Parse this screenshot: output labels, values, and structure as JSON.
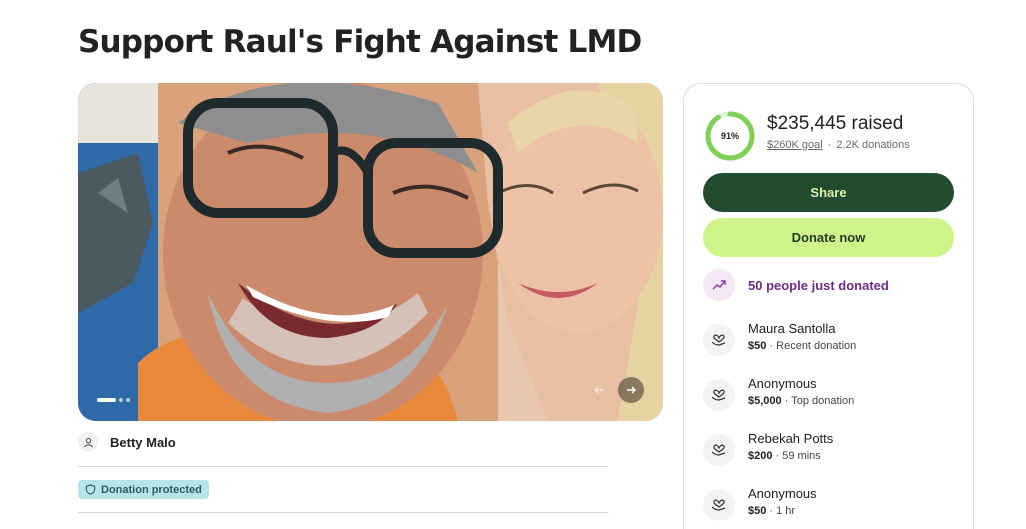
{
  "page": {
    "title": "Support Raul's Fight Against LMD"
  },
  "colors": {
    "accent_dark": "#224b30",
    "accent_light": "#cef48a",
    "progress_ring": "#7fcf58",
    "badge_bg": "#b5e5e8",
    "trend_text": "#6c2c8a"
  },
  "hero": {
    "slide_count": 3,
    "active_slide": 1,
    "prev_icon": "arrow-left-icon",
    "next_icon": "arrow-right-icon"
  },
  "organizer": {
    "name": "Betty Malo",
    "icon": "user-icon"
  },
  "badge": {
    "label": "Donation protected",
    "icon": "shield-icon"
  },
  "progress": {
    "percent_label": "91%",
    "percent": 0.91,
    "raised": "$235,445 raised",
    "goal": "$260K goal",
    "separator": "·",
    "donations": "2.2K donations"
  },
  "buttons": {
    "share": "Share",
    "donate": "Donate now"
  },
  "trend": {
    "text": "50 people just donated",
    "icon": "trending-up-icon"
  },
  "donations": [
    {
      "name": "Maura Santolla",
      "amount": "$50",
      "detail": " · Recent donation"
    },
    {
      "name": "Anonymous",
      "amount": "$5,000",
      "detail": " · Top donation"
    },
    {
      "name": "Rebekah Potts",
      "amount": "$200",
      "detail": " · 59 mins"
    },
    {
      "name": "Anonymous",
      "amount": "$50",
      "detail": " · 1 hr"
    }
  ]
}
